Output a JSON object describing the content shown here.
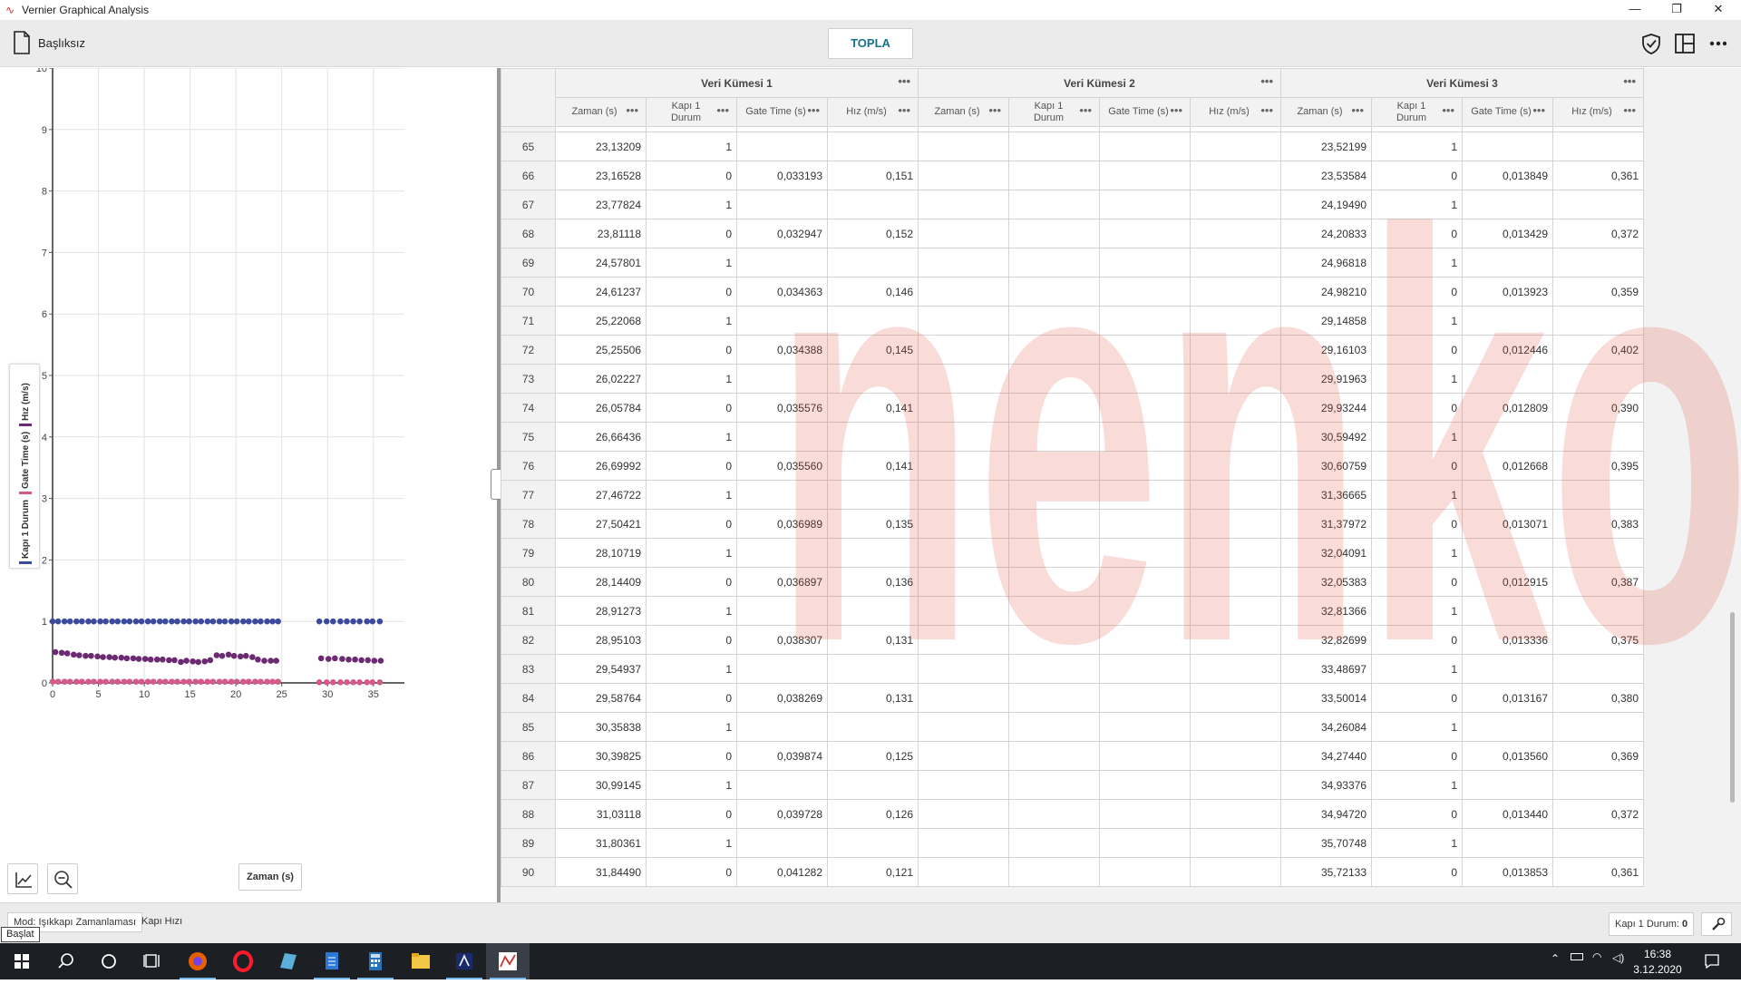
{
  "app": {
    "title": "Vernier Graphical Analysis",
    "document_name": "Başlıksız",
    "collect_label": "TOPLA"
  },
  "window_controls": {
    "minimize": "—",
    "restore": "❐",
    "close": "✕"
  },
  "graph": {
    "legend": [
      "Kapı 1 Durum",
      "Gate Time (s)",
      "Hız (m/s)"
    ],
    "legend_colors": [
      "#3b4a9c",
      "#d45a8a",
      "#6b2a72"
    ],
    "xlabel": "Zaman (s)",
    "y_ticks": [
      "0",
      "1",
      "2",
      "3",
      "4",
      "5",
      "6",
      "7",
      "8",
      "9",
      "10"
    ],
    "x_ticks": [
      "0",
      "5",
      "10",
      "15",
      "20",
      "25",
      "30",
      "35"
    ]
  },
  "chart_data": {
    "type": "scatter",
    "xlabel": "Zaman (s)",
    "ylabel": "",
    "xlim": [
      0,
      37
    ],
    "ylim": [
      0,
      10
    ],
    "grid": true,
    "legend_placement": "left-vertical",
    "series": [
      {
        "name": "Kapı 1 Durum",
        "color": "#3b4a9c",
        "x": [
          0,
          0.6,
          1.3,
          1.9,
          2.6,
          3.2,
          3.9,
          4.5,
          5.2,
          5.8,
          6.5,
          7.1,
          7.8,
          8.4,
          9.1,
          9.7,
          10.4,
          11,
          11.7,
          12.3,
          13,
          13.6,
          14.3,
          14.9,
          15.6,
          16.2,
          16.9,
          17.5,
          18.2,
          18.8,
          19.5,
          20.1,
          20.8,
          21.4,
          22.1,
          22.7,
          23.4,
          24,
          24.6,
          29.1,
          29.9,
          30.6,
          31.4,
          32.1,
          32.8,
          33.5,
          34.3,
          34.9,
          35.7
        ],
        "y": [
          1,
          1,
          1,
          1,
          1,
          1,
          1,
          1,
          1,
          1,
          1,
          1,
          1,
          1,
          1,
          1,
          1,
          1,
          1,
          1,
          1,
          1,
          1,
          1,
          1,
          1,
          1,
          1,
          1,
          1,
          1,
          1,
          1,
          1,
          1,
          1,
          1,
          1,
          1,
          1,
          1,
          1,
          1,
          1,
          1,
          1,
          1,
          1,
          1
        ]
      },
      {
        "name": "Gate Time (s)",
        "color": "#d45a8a",
        "x": [
          0,
          0.6,
          1.3,
          1.9,
          2.6,
          3.2,
          3.9,
          4.5,
          5.2,
          5.8,
          6.5,
          7.1,
          7.8,
          8.4,
          9.1,
          9.7,
          10.4,
          11,
          11.7,
          12.3,
          13,
          13.6,
          14.3,
          14.9,
          15.6,
          16.2,
          16.9,
          17.5,
          18.2,
          18.8,
          19.5,
          20.1,
          20.8,
          21.4,
          22.1,
          22.7,
          23.4,
          24,
          24.6,
          29.1,
          29.9,
          30.6,
          31.4,
          32.1,
          32.8,
          33.5,
          34.3,
          34.9,
          35.7
        ],
        "y": [
          0.02,
          0.02,
          0.02,
          0.02,
          0.02,
          0.02,
          0.02,
          0.02,
          0.02,
          0.02,
          0.02,
          0.02,
          0.02,
          0.02,
          0.02,
          0.02,
          0.02,
          0.02,
          0.02,
          0.02,
          0.02,
          0.02,
          0.02,
          0.02,
          0.02,
          0.02,
          0.02,
          0.02,
          0.02,
          0.02,
          0.02,
          0.02,
          0.02,
          0.02,
          0.02,
          0.02,
          0.02,
          0.02,
          0.02,
          0.01,
          0.01,
          0.01,
          0.01,
          0.01,
          0.01,
          0.01,
          0.01,
          0.01,
          0.01
        ]
      },
      {
        "name": "Hız (m/s)",
        "color": "#6b2a72",
        "x": [
          0.3,
          1,
          1.6,
          2.3,
          2.9,
          3.6,
          4.2,
          4.9,
          5.5,
          6.2,
          6.8,
          7.5,
          8.1,
          8.8,
          9.4,
          10.1,
          10.7,
          11.4,
          12,
          12.7,
          13.3,
          14,
          14.6,
          15.3,
          15.9,
          16.6,
          17.2,
          17.9,
          18.5,
          19.2,
          19.8,
          20.5,
          21.1,
          21.8,
          22.4,
          23.1,
          23.8,
          24.4,
          29.3,
          30.1,
          30.8,
          31.6,
          32.3,
          33,
          33.7,
          34.4,
          35.1,
          35.8
        ],
        "y": [
          0.5,
          0.49,
          0.48,
          0.46,
          0.45,
          0.44,
          0.44,
          0.43,
          0.42,
          0.42,
          0.41,
          0.41,
          0.4,
          0.4,
          0.39,
          0.39,
          0.38,
          0.38,
          0.38,
          0.37,
          0.37,
          0.34,
          0.36,
          0.35,
          0.34,
          0.35,
          0.37,
          0.45,
          0.44,
          0.46,
          0.44,
          0.43,
          0.44,
          0.42,
          0.38,
          0.36,
          0.36,
          0.36,
          0.4,
          0.39,
          0.4,
          0.39,
          0.38,
          0.38,
          0.37,
          0.37,
          0.36,
          0.36
        ]
      }
    ]
  },
  "table": {
    "sets": [
      "Veri Kümesi 1",
      "Veri Kümesi 2",
      "Veri Kümesi 3"
    ],
    "columns": [
      "Zaman (s)",
      "Kapı 1 Durum",
      "Gate Time (s)",
      "Hız (m/s)"
    ],
    "rows": [
      [
        "65",
        "23,13209",
        "1",
        "",
        "",
        "",
        "",
        "",
        "",
        "23,52199",
        "1",
        "",
        ""
      ],
      [
        "66",
        "23,16528",
        "0",
        "0,033193",
        "0,151",
        "",
        "",
        "",
        "",
        "23,53584",
        "0",
        "0,013849",
        "0,361"
      ],
      [
        "67",
        "23,77824",
        "1",
        "",
        "",
        "",
        "",
        "",
        "",
        "24,19490",
        "1",
        "",
        ""
      ],
      [
        "68",
        "23,81118",
        "0",
        "0,032947",
        "0,152",
        "",
        "",
        "",
        "",
        "24,20833",
        "0",
        "0,013429",
        "0,372"
      ],
      [
        "69",
        "24,57801",
        "1",
        "",
        "",
        "",
        "",
        "",
        "",
        "24,96818",
        "1",
        "",
        ""
      ],
      [
        "70",
        "24,61237",
        "0",
        "0,034363",
        "0,146",
        "",
        "",
        "",
        "",
        "24,98210",
        "0",
        "0,013923",
        "0,359"
      ],
      [
        "71",
        "25,22068",
        "1",
        "",
        "",
        "",
        "",
        "",
        "",
        "29,14858",
        "1",
        "",
        ""
      ],
      [
        "72",
        "25,25506",
        "0",
        "0,034388",
        "0,145",
        "",
        "",
        "",
        "",
        "29,16103",
        "0",
        "0,012446",
        "0,402"
      ],
      [
        "73",
        "26,02227",
        "1",
        "",
        "",
        "",
        "",
        "",
        "",
        "29,91963",
        "1",
        "",
        ""
      ],
      [
        "74",
        "26,05784",
        "0",
        "0,035576",
        "0,141",
        "",
        "",
        "",
        "",
        "29,93244",
        "0",
        "0,012809",
        "0,390"
      ],
      [
        "75",
        "26,66436",
        "1",
        "",
        "",
        "",
        "",
        "",
        "",
        "30,59492",
        "1",
        "",
        ""
      ],
      [
        "76",
        "26,69992",
        "0",
        "0,035560",
        "0,141",
        "",
        "",
        "",
        "",
        "30,60759",
        "0",
        "0,012668",
        "0,395"
      ],
      [
        "77",
        "27,46722",
        "1",
        "",
        "",
        "",
        "",
        "",
        "",
        "31,36665",
        "1",
        "",
        ""
      ],
      [
        "78",
        "27,50421",
        "0",
        "0,036989",
        "0,135",
        "",
        "",
        "",
        "",
        "31,37972",
        "0",
        "0,013071",
        "0,383"
      ],
      [
        "79",
        "28,10719",
        "1",
        "",
        "",
        "",
        "",
        "",
        "",
        "32,04091",
        "1",
        "",
        ""
      ],
      [
        "80",
        "28,14409",
        "0",
        "0,036897",
        "0,136",
        "",
        "",
        "",
        "",
        "32,05383",
        "0",
        "0,012915",
        "0,387"
      ],
      [
        "81",
        "28,91273",
        "1",
        "",
        "",
        "",
        "",
        "",
        "",
        "32,81366",
        "1",
        "",
        ""
      ],
      [
        "82",
        "28,95103",
        "0",
        "0,038307",
        "0,131",
        "",
        "",
        "",
        "",
        "32,82699",
        "0",
        "0,013336",
        "0,375"
      ],
      [
        "83",
        "29,54937",
        "1",
        "",
        "",
        "",
        "",
        "",
        "",
        "33,48697",
        "1",
        "",
        ""
      ],
      [
        "84",
        "29,58764",
        "0",
        "0,038269",
        "0,131",
        "",
        "",
        "",
        "",
        "33,50014",
        "0",
        "0,013167",
        "0,380"
      ],
      [
        "85",
        "30,35838",
        "1",
        "",
        "",
        "",
        "",
        "",
        "",
        "34,26084",
        "1",
        "",
        ""
      ],
      [
        "86",
        "30,39825",
        "0",
        "0,039874",
        "0,125",
        "",
        "",
        "",
        "",
        "34,27440",
        "0",
        "0,013560",
        "0,369"
      ],
      [
        "87",
        "30,99145",
        "1",
        "",
        "",
        "",
        "",
        "",
        "",
        "34,93376",
        "1",
        "",
        ""
      ],
      [
        "88",
        "31,03118",
        "0",
        "0,039728",
        "0,126",
        "",
        "",
        "",
        "",
        "34,94720",
        "0",
        "0,013440",
        "0,372"
      ],
      [
        "89",
        "31,80361",
        "1",
        "",
        "",
        "",
        "",
        "",
        "",
        "35,70748",
        "1",
        "",
        ""
      ],
      [
        "90",
        "31,84490",
        "0",
        "0,041282",
        "0,121",
        "",
        "",
        "",
        "",
        "35,72133",
        "0",
        "0,013853",
        "0,361"
      ]
    ]
  },
  "status": {
    "mode_tab_1": "Mod: Işıkkapı Zamanlaması",
    "mode_tab_2": "Kapı Hızı",
    "tooltip": "Başlat",
    "sensor_label": "Kapı 1 Durum:",
    "sensor_value": "0"
  },
  "watermark": "nenko",
  "taskbar": {
    "time": "16:38",
    "date": "3.12.2020"
  }
}
